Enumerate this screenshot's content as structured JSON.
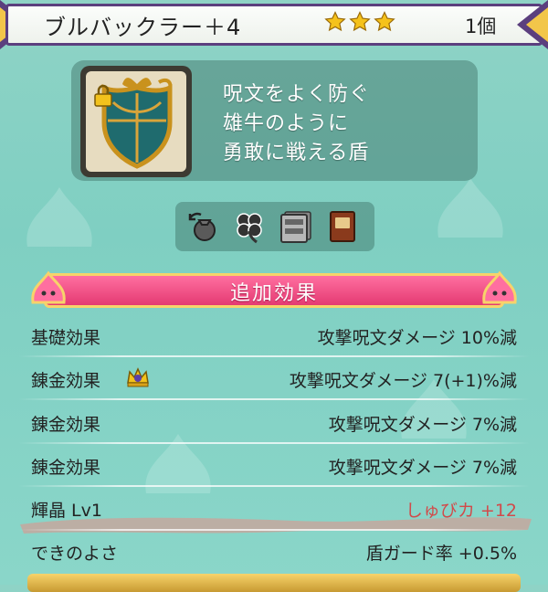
{
  "header": {
    "title": "ブルバックラー＋4",
    "stars": 3,
    "count": "1個"
  },
  "item": {
    "icon": "shield-icon",
    "locked": true,
    "description": [
      "呪文をよく防ぐ",
      "雄牛のように",
      "勇敢に戦える盾"
    ]
  },
  "action_icons": [
    "bag-icon",
    "clover-icon",
    "cabinet-icon",
    "book-icon"
  ],
  "section": {
    "title": "追加効果"
  },
  "effects": [
    {
      "label": "基礎効果",
      "value": "攻撃呪文ダメージ 10%減"
    },
    {
      "label": "錬金効果",
      "value": "攻撃呪文ダメージ 7(+1)%減",
      "badge": "crown-icon"
    },
    {
      "label": "錬金効果",
      "value": "攻撃呪文ダメージ 7%減"
    },
    {
      "label": "錬金効果",
      "value": "攻撃呪文ダメージ 7%減"
    },
    {
      "label": "輝晶 Lv1",
      "value": "しゅびカ +12",
      "highlight": true
    },
    {
      "label": "できのよさ",
      "value": "盾ガード率 +0.5%"
    }
  ],
  "colors": {
    "background": "#8fd3c6",
    "frame": "#5b3f7e",
    "ribbon": "#e43a72",
    "gold": "#f7d36a",
    "highlight_text": "#d24a4a"
  }
}
